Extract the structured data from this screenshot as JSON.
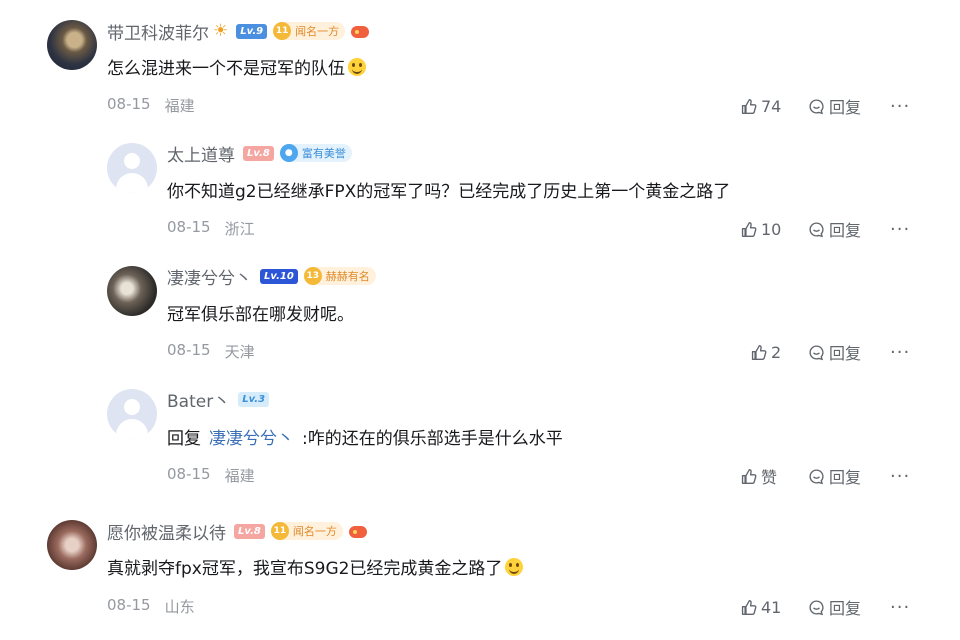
{
  "comments": [
    {
      "username": "带卫科波菲尔",
      "level": "Lv.9",
      "medal": "闻名一方",
      "medal_num": "11",
      "text": "怎么混进来一个不是冠军的队伍",
      "date": "08-15",
      "location": "福建",
      "likes": "74",
      "reply_label": "回复",
      "more": "···"
    },
    {
      "username": "太上道尊",
      "level": "Lv.8",
      "medal": "富有美誉",
      "text": "你不知道g2已经继承FPX的冠军了吗？已经完成了历史上第一个黄金之路了",
      "date": "08-15",
      "location": "浙江",
      "likes": "10",
      "reply_label": "回复",
      "more": "···"
    },
    {
      "username": "凄凄兮兮丶",
      "level": "Lv.10",
      "medal": "赫赫有名",
      "medal_num": "13",
      "text": "冠军俱乐部在哪发财呢。",
      "date": "08-15",
      "location": "天津",
      "likes": "2",
      "reply_label": "回复",
      "more": "···"
    },
    {
      "username": "Bater丶",
      "level": "Lv.3",
      "reply_prefix": "回复",
      "mention": "凄凄兮兮丶",
      "text": ":咋的还在的俱乐部选手是什么水平",
      "date": "08-15",
      "location": "福建",
      "likes": "赞",
      "reply_label": "回复",
      "more": "···"
    },
    {
      "username": "愿你被温柔以待",
      "level": "Lv.8",
      "medal": "闻名一方",
      "medal_num": "11",
      "text": "真就剥夺fpx冠军，我宣布S9G2已经完成黄金之路了",
      "date": "08-15",
      "location": "山东",
      "likes": "41",
      "reply_label": "回复",
      "more": "···"
    }
  ],
  "icons": {
    "sun": "sun-icon",
    "like": "thumbs-up-icon",
    "reply": "reply-bubble-icon",
    "more": "more-dots-icon"
  },
  "colors": {
    "username": "#61666d",
    "mention": "#3a6fb7",
    "meta": "#9499a0"
  }
}
